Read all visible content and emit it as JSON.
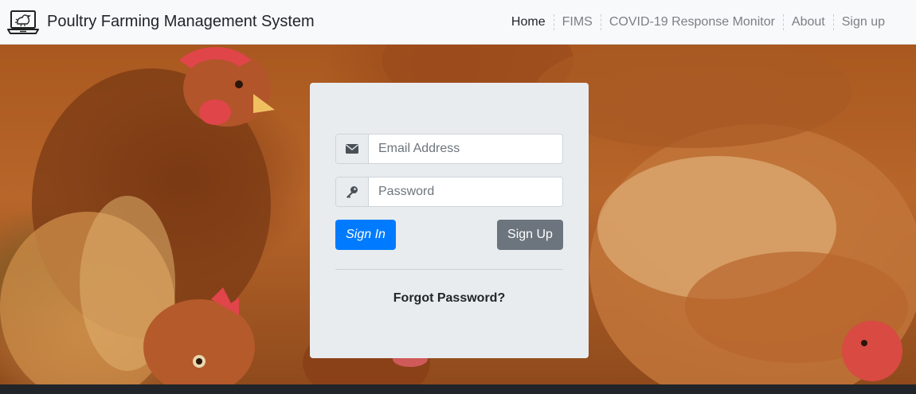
{
  "navbar": {
    "brand_icon": "laptop-chicken-icon",
    "brand_title": "Poultry Farming Management System",
    "items": [
      {
        "label": "Home",
        "active": true
      },
      {
        "label": "FIMS",
        "active": false
      },
      {
        "label": "COVID-19 Response Monitor",
        "active": false
      },
      {
        "label": "About",
        "active": false
      },
      {
        "label": "Sign up",
        "active": false
      }
    ]
  },
  "login": {
    "email_icon": "envelope-icon",
    "email_placeholder": "Email Address",
    "password_icon": "key-icon",
    "password_placeholder": "Password",
    "signin_label": "Sign In",
    "signup_label": "Sign Up",
    "forgot_label": "Forgot Password?"
  },
  "colors": {
    "primary": "#007bff",
    "secondary": "#6c757d",
    "card_bg": "#e9ecef",
    "navbar_bg": "#f8f9fa",
    "footer_bg": "#212529"
  }
}
